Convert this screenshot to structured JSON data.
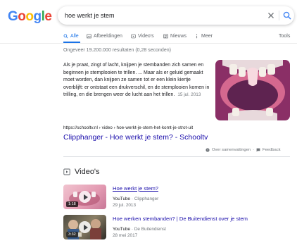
{
  "logo": {
    "letters": [
      "G",
      "o",
      "o",
      "g",
      "l",
      "e"
    ],
    "colors": [
      "#4285F4",
      "#EA4335",
      "#FBBC05",
      "#4285F4",
      "#34A853",
      "#EA4335"
    ]
  },
  "search": {
    "query": "hoe werkt je stem"
  },
  "tabs": [
    {
      "label": "Alle",
      "icon": "search-icon",
      "active": true
    },
    {
      "label": "Afbeeldingen",
      "icon": "image-icon",
      "active": false
    },
    {
      "label": "Video's",
      "icon": "video-icon",
      "active": false
    },
    {
      "label": "Nieuws",
      "icon": "news-icon",
      "active": false
    },
    {
      "label": "Meer",
      "icon": "more-icon",
      "active": false
    }
  ],
  "tools_label": "Tools",
  "stats": "Ongeveer 19.200.000 resultaten (0,28 seconden)",
  "snippet": {
    "text": "Als je praat, zingt of lacht, knijpen je stembanden zich samen en beginnen je stemplooien te trillen. ... Maar als er geluid gemaakt moet worden, dan knijpen ze samen tot er een klein kiertje overblijft: er ontstaat een drukverschil, en de stemplooien komen in trilling, en die brengen weer de lucht aan het trillen.",
    "date": "15 jul. 2013",
    "url": "https://schooltv.nl › video › hoe-werkt-je-stem-het-komt-je-strot-uit",
    "title": "Clipphanger - Hoe werkt je stem? - Schooltv",
    "about_label": "Over samenvattingen",
    "feedback_label": "Feedback"
  },
  "videos": {
    "heading": "Video's",
    "items": [
      {
        "title": "Hoe werkt je stem?",
        "source": "YouTube",
        "channel": "Clipphanger",
        "date": "29 jul. 2013",
        "duration": "1:18"
      },
      {
        "title": "Hoe werken stembanden? | De Buitendienst over je stem",
        "source": "YouTube",
        "channel": "De Buitendienst",
        "date": "28 mei 2017",
        "duration": "3:32"
      }
    ]
  },
  "colors": {
    "link": "#1a0dab",
    "accent": "#1a73e8",
    "meta": "#70757a"
  }
}
